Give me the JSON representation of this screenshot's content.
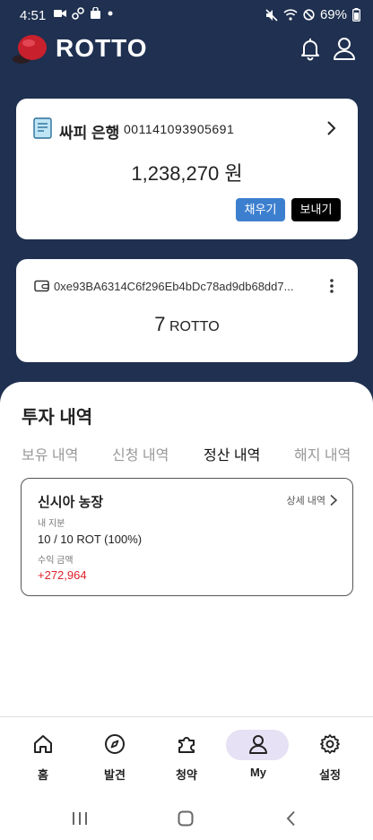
{
  "status_bar": {
    "time": "4:51",
    "battery": "69%"
  },
  "header": {
    "brand": "ROTTO"
  },
  "bank_card": {
    "bank_name": "싸피 은행",
    "account_number": "001141093905691",
    "balance": "1,238,270 원",
    "fill_label": "채우기",
    "send_label": "보내기"
  },
  "wallet_card": {
    "address": "0xe93BA6314C6f296Eb4bDc78ad9db68dd7...",
    "balance_number": "7",
    "balance_unit": "ROTTO"
  },
  "investments": {
    "title": "투자 내역",
    "tabs": [
      {
        "label": "보유 내역"
      },
      {
        "label": "신청 내역"
      },
      {
        "label": "정산 내역"
      },
      {
        "label": "해지 내역"
      }
    ],
    "active_tab": "정산 내역",
    "holding": {
      "name": "신시아 농장",
      "detail_label": "상세 내역",
      "share_label": "내 지분",
      "share_value": "10 / 10 ROT (100%)",
      "profit_label": "수익 금액",
      "profit_value": "+272,964"
    }
  },
  "bottom_nav": {
    "items": [
      {
        "label": "홈",
        "icon": "home-icon"
      },
      {
        "label": "발견",
        "icon": "compass-icon"
      },
      {
        "label": "청약",
        "icon": "puzzle-icon"
      },
      {
        "label": "My",
        "icon": "user-icon"
      },
      {
        "label": "설정",
        "icon": "gear-icon"
      }
    ],
    "active": "My"
  },
  "colors": {
    "header_bg": "#1f3050",
    "fill_button": "#3d7fcf",
    "send_button": "#000000",
    "profit": "#e0202a",
    "active_nav_pill": "#e6e1f4"
  }
}
